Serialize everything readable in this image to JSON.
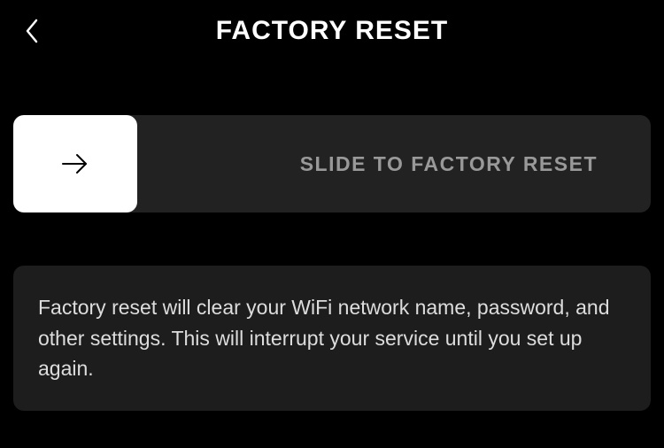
{
  "header": {
    "title": "FACTORY RESET"
  },
  "slider": {
    "label": "SLIDE TO FACTORY RESET"
  },
  "info": {
    "text": "Factory reset will clear your WiFi network name, password, and other settings. This will interrupt your service until you set up again."
  }
}
